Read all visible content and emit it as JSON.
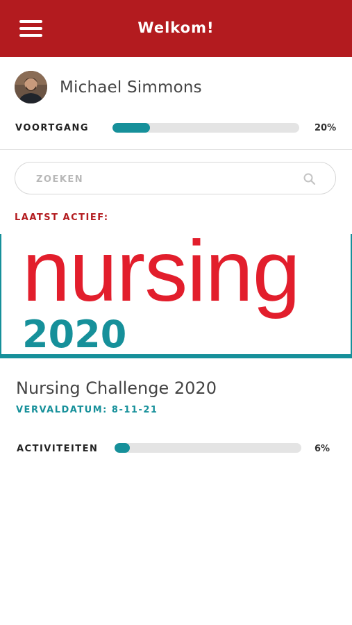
{
  "header": {
    "title": "Welkom!",
    "menu_icon": "hamburger-menu-icon"
  },
  "profile": {
    "name": "Michael Simmons",
    "avatar_icon": "user-avatar"
  },
  "progress": {
    "label": "VOORTGANG",
    "value": 0.2,
    "percent_text": "20%"
  },
  "search": {
    "placeholder": "ZOEKEN",
    "value": "",
    "icon": "search-icon"
  },
  "recent": {
    "label": "LAATST ACTIEF:",
    "banner_word": "nursing",
    "banner_year": "2020",
    "course_title": "Nursing Challenge 2020",
    "due_text": "VERVALDATUM: 8-11-21",
    "activities_label": "ACTIVITEITEN",
    "activities_value": 0.06,
    "activities_percent_text": "6%"
  },
  "colors": {
    "header": "#b31b1f",
    "accent": "#16909a",
    "track": "#e4e4e4",
    "banner_red": "#e21e2c"
  }
}
